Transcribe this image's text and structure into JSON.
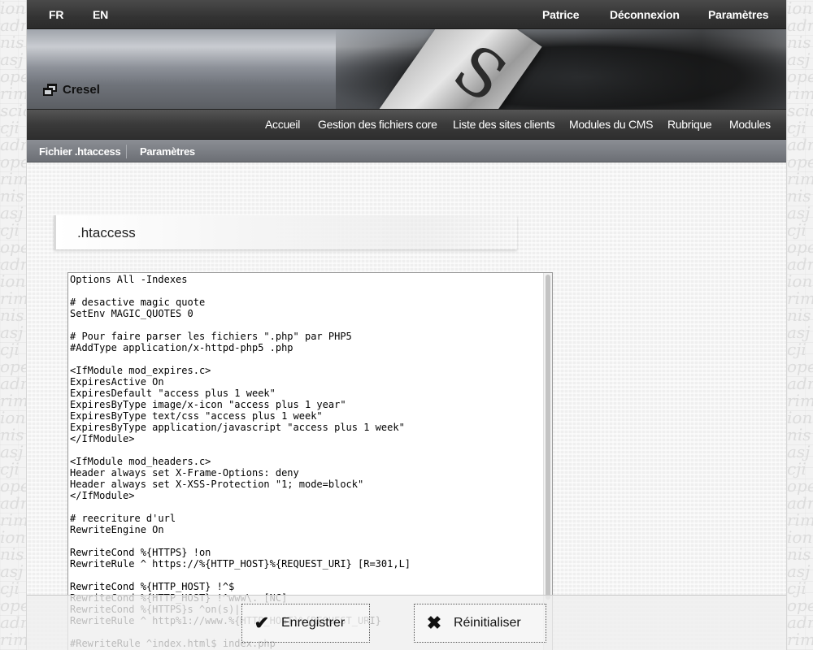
{
  "topbar": {
    "lang_fr": "FR",
    "lang_en": "EN",
    "user": "Patrice",
    "logout": "Déconnexion",
    "settings": "Paramètres"
  },
  "banner": {
    "brand": "Cresel",
    "brand_icon": "window-restore-icon"
  },
  "main_nav": {
    "items": [
      {
        "label": "Accueil"
      },
      {
        "label": "Gestion des fichiers core"
      },
      {
        "label": "Liste des sites clients"
      },
      {
        "label": "Modules du CMS"
      },
      {
        "label": "Rubrique"
      },
      {
        "label": "Modules"
      }
    ]
  },
  "sub_nav": {
    "items": [
      {
        "label": "Fichier .htaccess"
      },
      {
        "label": "Paramètres"
      }
    ]
  },
  "content": {
    "heading": ".htaccess",
    "htaccess_text": "Options All -Indexes\n\n# desactive magic quote\nSetEnv MAGIC_QUOTES 0\n\n# Pour faire parser les fichiers \".php\" par PHP5\n#AddType application/x-httpd-php5 .php\n\n<IfModule mod_expires.c>\nExpiresActive On\nExpiresDefault \"access plus 1 week\"\nExpiresByType image/x-icon \"access plus 1 year\"\nExpiresByType text/css \"access plus 1 week\"\nExpiresByType application/javascript \"access plus 1 week\"\n</IfModule>\n\n<IfModule mod_headers.c>\nHeader always set X-Frame-Options: deny\nHeader always set X-XSS-Protection \"1; mode=block\"\n</IfModule>\n\n# reecriture d'url\nRewriteEngine On\n\nRewriteCond %{HTTPS} !on\nRewriteRule ^ https://%{HTTP_HOST}%{REQUEST_URI} [R=301,L]\n\nRewriteCond %{HTTP_HOST} !^$\nRewriteCond %{HTTP_HOST} !^www\\. [NC]\nRewriteCond %{HTTPS}s ^on(s)|\nRewriteRule ^ http%1://www.%{HTTP_HOST}%{REQUEST_URI}\n\n#RewriteRule ^index.html$ index.php"
  },
  "actions": {
    "save_label": "Enregistrer",
    "save_icon": "checkmark-icon",
    "reset_label": "Réinitialiser",
    "reset_icon": "x-icon"
  },
  "side_pattern_text": "ion\nadm\nnis\nasj\nope\nrim\nscio\ncji\nadm\nope\nrim\nnis\nasj\ncji\nope\nadm\nion\nrim\nnis\nasj\ncji\nope\nadm\nrim\nion\nnis\nasj\ncji\nope\nadm\nrim\nion\nnis\nasj\ncji\nope\nadm\nrim"
}
